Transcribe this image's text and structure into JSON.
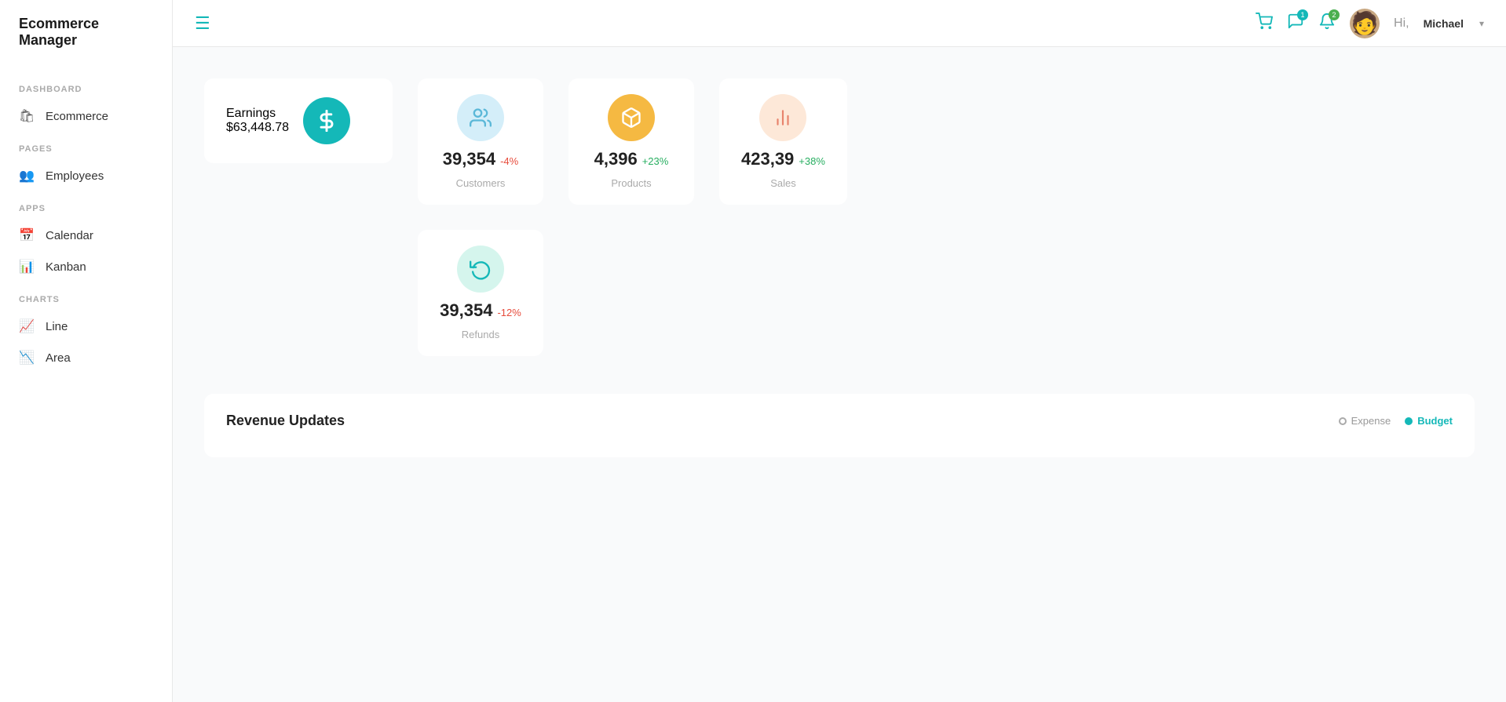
{
  "sidebar": {
    "logo": "Ecommerce Manager",
    "sections": [
      {
        "label": "DASHBOARD",
        "items": [
          {
            "id": "ecommerce",
            "label": "Ecommerce",
            "icon": "🛍"
          }
        ]
      },
      {
        "label": "PAGES",
        "items": [
          {
            "id": "employees",
            "label": "Employees",
            "icon": "👥"
          }
        ]
      },
      {
        "label": "APPS",
        "items": [
          {
            "id": "calendar",
            "label": "Calendar",
            "icon": "📅"
          },
          {
            "id": "kanban",
            "label": "Kanban",
            "icon": "📊"
          }
        ]
      },
      {
        "label": "CHARTS",
        "items": [
          {
            "id": "line",
            "label": "Line",
            "icon": "📈"
          },
          {
            "id": "area",
            "label": "Area",
            "icon": "📉"
          }
        ]
      }
    ]
  },
  "header": {
    "hamburger_icon": "☰",
    "greeting": "Hi,",
    "user_name": "Michael",
    "chevron": "▾",
    "cart_icon": "🛒",
    "message_icon": "💬",
    "bell_icon": "🔔",
    "cart_badge": "",
    "message_badge": "1",
    "bell_badge": "2"
  },
  "earnings": {
    "label": "Earnings",
    "value": "$63,448.78",
    "icon": "$"
  },
  "stats": [
    {
      "id": "customers",
      "number": "39,354",
      "change": "-4%",
      "change_type": "negative",
      "label": "Customers",
      "icon": "👥",
      "circle_class": "light-blue"
    },
    {
      "id": "products",
      "number": "4,396",
      "change": "+23%",
      "change_type": "positive",
      "label": "Products",
      "icon": "📦",
      "circle_class": "yellow"
    },
    {
      "id": "sales",
      "number": "423,39",
      "change": "+38%",
      "change_type": "positive",
      "label": "Sales",
      "icon": "📊",
      "circle_class": "peach"
    }
  ],
  "refunds": {
    "id": "refunds",
    "number": "39,354",
    "change": "-12%",
    "change_type": "negative",
    "label": "Refunds",
    "icon": "🔄",
    "circle_class": "mint"
  },
  "revenue": {
    "title": "Revenue Updates",
    "legend": [
      {
        "id": "expense",
        "label": "Expense",
        "dot_class": ""
      },
      {
        "id": "budget",
        "label": "Budget",
        "dot_class": "teal",
        "label_class": "legend-label-teal"
      }
    ]
  }
}
